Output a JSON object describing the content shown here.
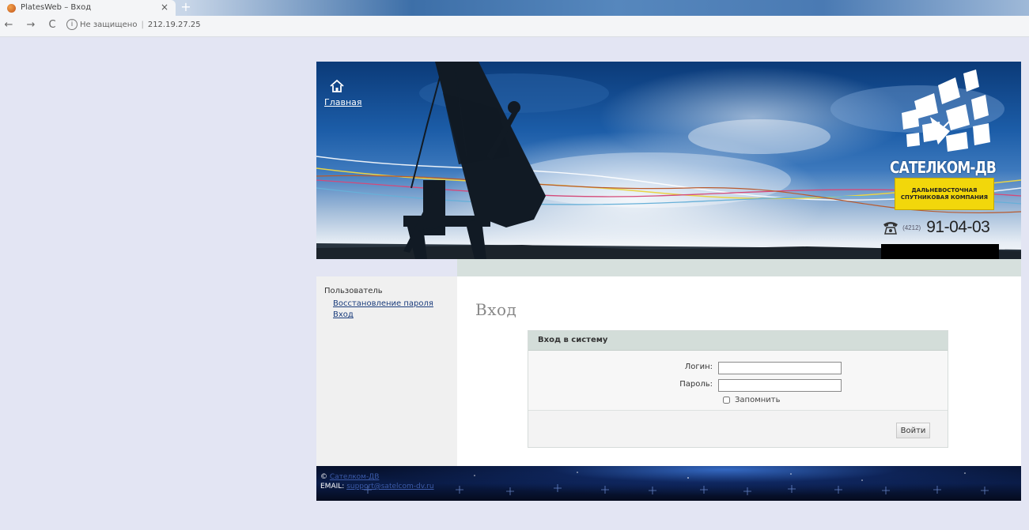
{
  "browser": {
    "tab_title": "PlatesWeb – Вход",
    "tab_close": "×",
    "new_tab": "+",
    "back": "←",
    "forward": "→",
    "reload": "C",
    "security_label": "Не защищено",
    "url_host": "212.19.27.25"
  },
  "header": {
    "home_label": "Главная",
    "brand": {
      "name": "САТЕЛКОМ-ДВ",
      "tagline": "ДАЛЬНЕВОСТОЧНАЯ СПУТНИКОВАЯ КОМПАНИЯ",
      "phone_code": "(4212)",
      "phone_number": "91-04-03",
      "accent_color": "#f2d70b"
    }
  },
  "sidebar": {
    "title": "Пользователь",
    "links": [
      "Восстановление пароля",
      "Вход"
    ]
  },
  "main": {
    "page_title": "Вход",
    "login_box": {
      "title": "Вход в систему",
      "login_label": "Логин:",
      "login_value": "",
      "password_label": "Пароль:",
      "password_value": "",
      "remember_label": "Запомнить",
      "remember_checked": false,
      "submit_label": "Войти"
    }
  },
  "footer": {
    "copyright_prefix": "©",
    "copyright_link": "Сателком-ДВ",
    "email_label": "EMAIL:",
    "email_link": "support@satelcom-dv.ru"
  }
}
